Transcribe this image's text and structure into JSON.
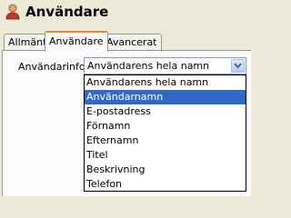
{
  "window": {
    "title": "Användare",
    "icon": "user-icon"
  },
  "tabs": [
    {
      "label": "Allmänt",
      "active": false
    },
    {
      "label": "Användare",
      "active": true
    },
    {
      "label": "Avancerat",
      "active": false
    }
  ],
  "form": {
    "field_label": "Användarinfo:",
    "selected_value": "Användarens hela namn"
  },
  "dropdown": {
    "highlighted_index": 1,
    "options": [
      "Användarens hela namn",
      "Användarnamn",
      "E-postadress",
      "Förnamn",
      "Efternamn",
      "Titel",
      "Beskrivning",
      "Telefon"
    ]
  },
  "colors": {
    "highlight": "#316ac5",
    "active_tab_accent": "#e68b2c"
  }
}
